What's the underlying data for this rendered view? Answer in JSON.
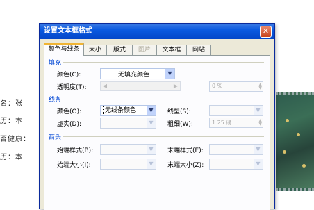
{
  "background_doc": {
    "lines": [
      "名：张",
      "历：本",
      "否健康：",
      "历：本"
    ]
  },
  "dialog": {
    "title": "设置文本框格式",
    "close_symbol": "✕",
    "tabs": [
      {
        "label": "颜色与线条",
        "active": true,
        "disabled": false
      },
      {
        "label": "大小",
        "active": false,
        "disabled": false
      },
      {
        "label": "版式",
        "active": false,
        "disabled": false
      },
      {
        "label": "图片",
        "active": false,
        "disabled": true
      },
      {
        "label": "文本框",
        "active": false,
        "disabled": false
      },
      {
        "label": "网站",
        "active": false,
        "disabled": false
      }
    ],
    "fill": {
      "section_label": "填充",
      "color_label": "颜色(C):",
      "color_value": "无填充颜色",
      "transparency_label": "透明度(T):",
      "transparency_value": "0 %"
    },
    "line": {
      "section_label": "线条",
      "color_label": "颜色(O):",
      "color_value": "无线条颜色",
      "linetype_label": "线型(S):",
      "dash_label": "虚实(D):",
      "weight_label": "粗细(W):",
      "weight_value": "1.25 磅"
    },
    "arrows": {
      "section_label": "箭头",
      "begin_style_label": "始端样式(B):",
      "end_style_label": "末端样式(E):",
      "begin_size_label": "始端大小(I):",
      "end_size_label": "末端大小(Z):"
    }
  }
}
